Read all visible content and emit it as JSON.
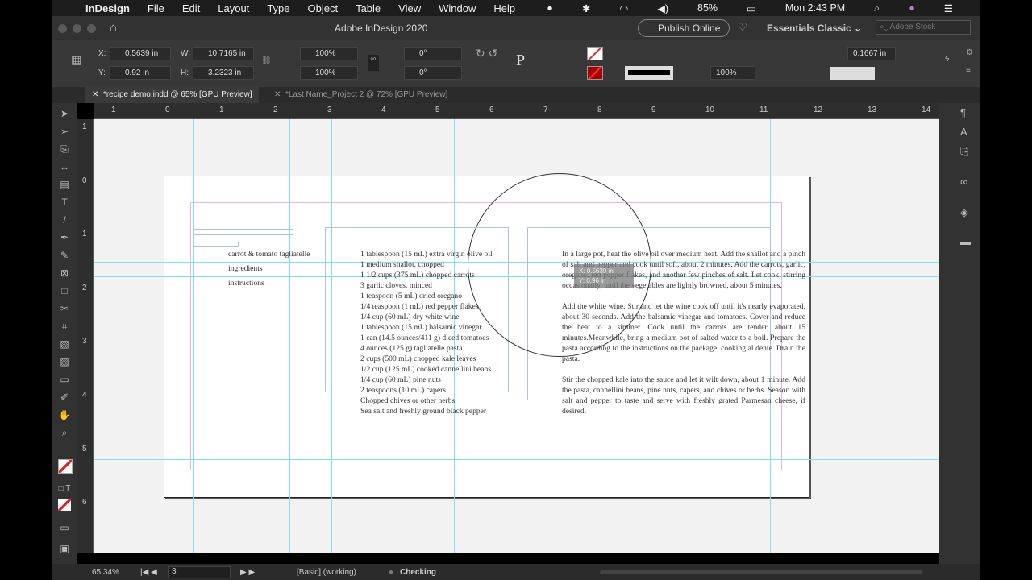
{
  "menubar": {
    "app": "InDesign",
    "items": [
      "File",
      "Edit",
      "Layout",
      "Type",
      "Object",
      "Table",
      "View",
      "Window",
      "Help"
    ],
    "battery": "85%",
    "clock": "Mon 2:43 PM"
  },
  "titlebar": {
    "title": "Adobe InDesign 2020",
    "publish": "Publish Online",
    "workspace": "Essentials Classic",
    "search_placeholder": "Adobe Stock"
  },
  "control": {
    "x_label": "X:",
    "x": "0.5639 in",
    "y_label": "Y:",
    "y": "0.92 in",
    "w_label": "W:",
    "w": "10.7165 in",
    "h_label": "H:",
    "h": "3.2323 in",
    "scale_x": "100%",
    "scale_y": "100%",
    "rotate": "0°",
    "shear": "0°",
    "opacity": "100%",
    "gutter": "0.1667 in"
  },
  "tabs": [
    {
      "label": "*recipe demo.indd @ 65% [GPU Preview]",
      "active": true
    },
    {
      "label": "*Last Name_Project 2 @ 72% [GPU Preview]",
      "active": false
    }
  ],
  "rulers": {
    "h": [
      "1",
      "0",
      "1",
      "2",
      "3",
      "4",
      "5",
      "6",
      "7",
      "8",
      "9",
      "10",
      "11",
      "12",
      "13",
      "14"
    ],
    "v": [
      "1",
      "0",
      "1",
      "2",
      "3",
      "4",
      "5",
      "6"
    ]
  },
  "document": {
    "title": "carrot & tomato tagliatelle",
    "label_ingredients": "ingredients",
    "label_instructions": "instructions",
    "ingredients": [
      "1 tablespoon (15 mL) extra virgin olive oil",
      "1 medium shallot, chopped",
      "1 1/2 cups (375 mL) chopped carrots",
      "3 garlic cloves, minced",
      "1 teaspoon (5 mL) dried oregano",
      "1/4 teaspoon (1 mL) red pepper flakes",
      "1/4 cup (60 mL) dry white wine",
      "1 tablespoon (15 mL) balsamic vinegar",
      "1 can (14.5 ounces/411 g) diced tomatoes",
      "4 ounces (125 g) tagliatelle pasta",
      "2 cups (500 mL) chopped kale leaves",
      "1/2 cup (125 mL) cooked cannellini beans",
      "1/4 cup (60 mL) pine nuts",
      "2 teaspoons (10 mL) capers",
      "Chopped chives or other herbs",
      "Sea salt and freshly ground black pepper"
    ],
    "instructions": [
      "In a large pot, heat the olive oil over medium heat. Add the shallot and a pinch of salt and pepper and cook until soft, about 2 minutes. Add the carrots, garlic, oregano, red pepper flakes, and another few pinches of salt. Let cook, stirring occasionally, until the vegetables are lightly browned, about 5 minutes.",
      "Add the white wine. Stir and let the wine cook off until it's nearly evaporated, about 30 seconds. Add the balsamic vinegar and tomatoes. Cover and reduce the heat to a simmer. Cook until the carrots are tender, about 15 minutes.Meanwhile, bring a medium pot of salted water to a boil. Prepare the pasta according to the instructions on the package, cooking al dente. Drain the pasta.",
      "Stir the chopped kale into the sauce and let it wilt down, about 1 minute. Add the pasta, cannellini beans, pine nuts, capers, and chives or herbs. Season with salt and pepper to taste and serve with freshly grated Parmesan cheese, if desired."
    ],
    "tooltip_x": "X: 0.5639 in",
    "tooltip_y": "Y: 0.96 in"
  },
  "status": {
    "zoom": "65.34%",
    "page": "3",
    "style": "[Basic] (working)",
    "preflight": "Checking"
  }
}
